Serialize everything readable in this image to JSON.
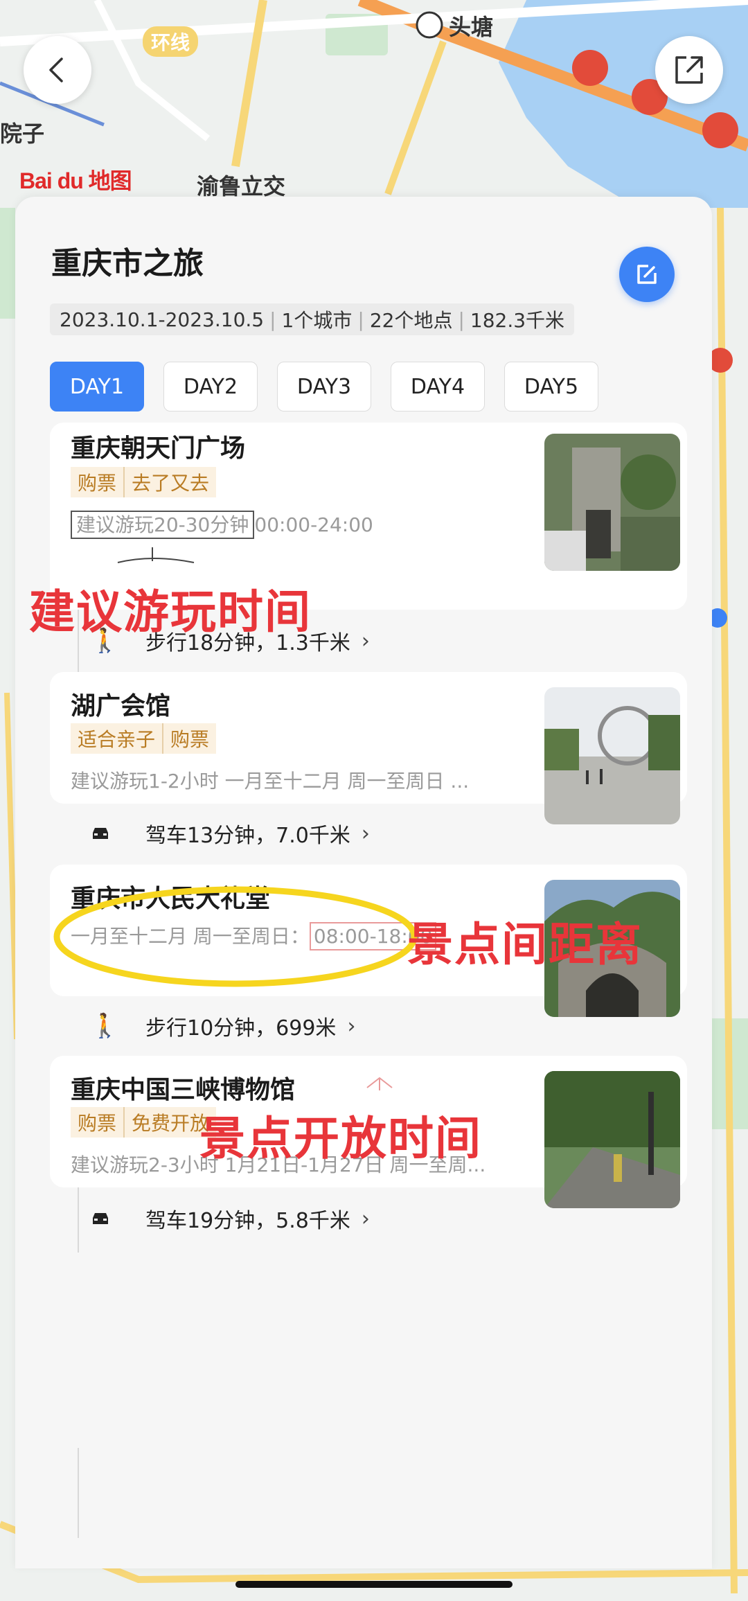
{
  "map": {
    "labels": [
      "头塘",
      "渝鲁立交",
      "院子"
    ],
    "ring_road": "环线",
    "logo": "Bai du 地图"
  },
  "trip": {
    "title": "重庆市之旅",
    "summary": [
      "2023.10.1-2023.10.5",
      "1个城市",
      "22个地点",
      "182.3千米"
    ],
    "days": [
      "DAY1",
      "DAY2",
      "DAY3",
      "DAY4",
      "DAY5"
    ],
    "active_day": "DAY1"
  },
  "pois": [
    {
      "name": "重庆朝天门广场",
      "tags": [
        "购票",
        "去了又去"
      ],
      "suggest": "建议游玩20-30分钟",
      "hours": "00:00-24:00"
    },
    {
      "name": "湖广会馆",
      "tags": [
        "适合亲子",
        "购票"
      ],
      "info": "建议游玩1-2小时 一月至十二月 周一至周日 ..."
    },
    {
      "name": "重庆市人民大礼堂",
      "info_prefix": "一月至十二月 周一至周日：",
      "hours": "08:00-18:00"
    },
    {
      "name": "重庆中国三峡博物馆",
      "tags": [
        "购票",
        "免费开放"
      ],
      "info": "建议游玩2-3小时 1月21日-1月27日 周一至周..."
    }
  ],
  "routes": [
    {
      "mode": "walk",
      "text": "步行18分钟，1.3千米"
    },
    {
      "mode": "car",
      "text": "驾车13分钟，7.0千米"
    },
    {
      "mode": "walk",
      "text": "步行10分钟，699米"
    },
    {
      "mode": "car",
      "text": "驾车19分钟，5.8千米"
    }
  ],
  "annotations": {
    "play_time": "建议游玩时间",
    "distance": "景点间距离",
    "open_time": "景点开放时间"
  },
  "colors": {
    "accent": "#3d83f5",
    "tag_bg": "#fbf1e1",
    "tag_text": "#b97c24",
    "annotation_red": "#e8353a",
    "highlight_yellow": "#f6d51e"
  }
}
